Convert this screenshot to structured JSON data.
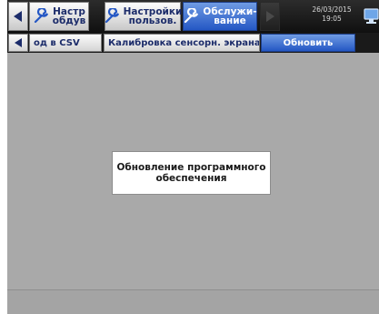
{
  "topbar": {
    "tabs": [
      {
        "label": "Настр\nобдув",
        "icon": "wrench-icon",
        "active": false
      },
      {
        "label": "Настройки\nпользов.",
        "icon": "wrench-icon",
        "active": false
      },
      {
        "label": "Обслужи-\nвание",
        "icon": "wrench-icon",
        "active": true
      }
    ],
    "date": "26/03/2015",
    "time": "19:05"
  },
  "subbar": {
    "tabs": [
      {
        "label": "од в CSV",
        "active": false
      },
      {
        "label": "Калибровка сенсорн. экрана",
        "active": false
      },
      {
        "label": "Обновить",
        "active": true
      }
    ]
  },
  "dialog": {
    "line1": "Обновление программного",
    "line2": "обеспечения"
  },
  "colors": {
    "accent": "#2457c4",
    "topbar_bg": "#141414",
    "screen_bg": "#a9a9a9",
    "label_text": "#1c2c6a"
  }
}
